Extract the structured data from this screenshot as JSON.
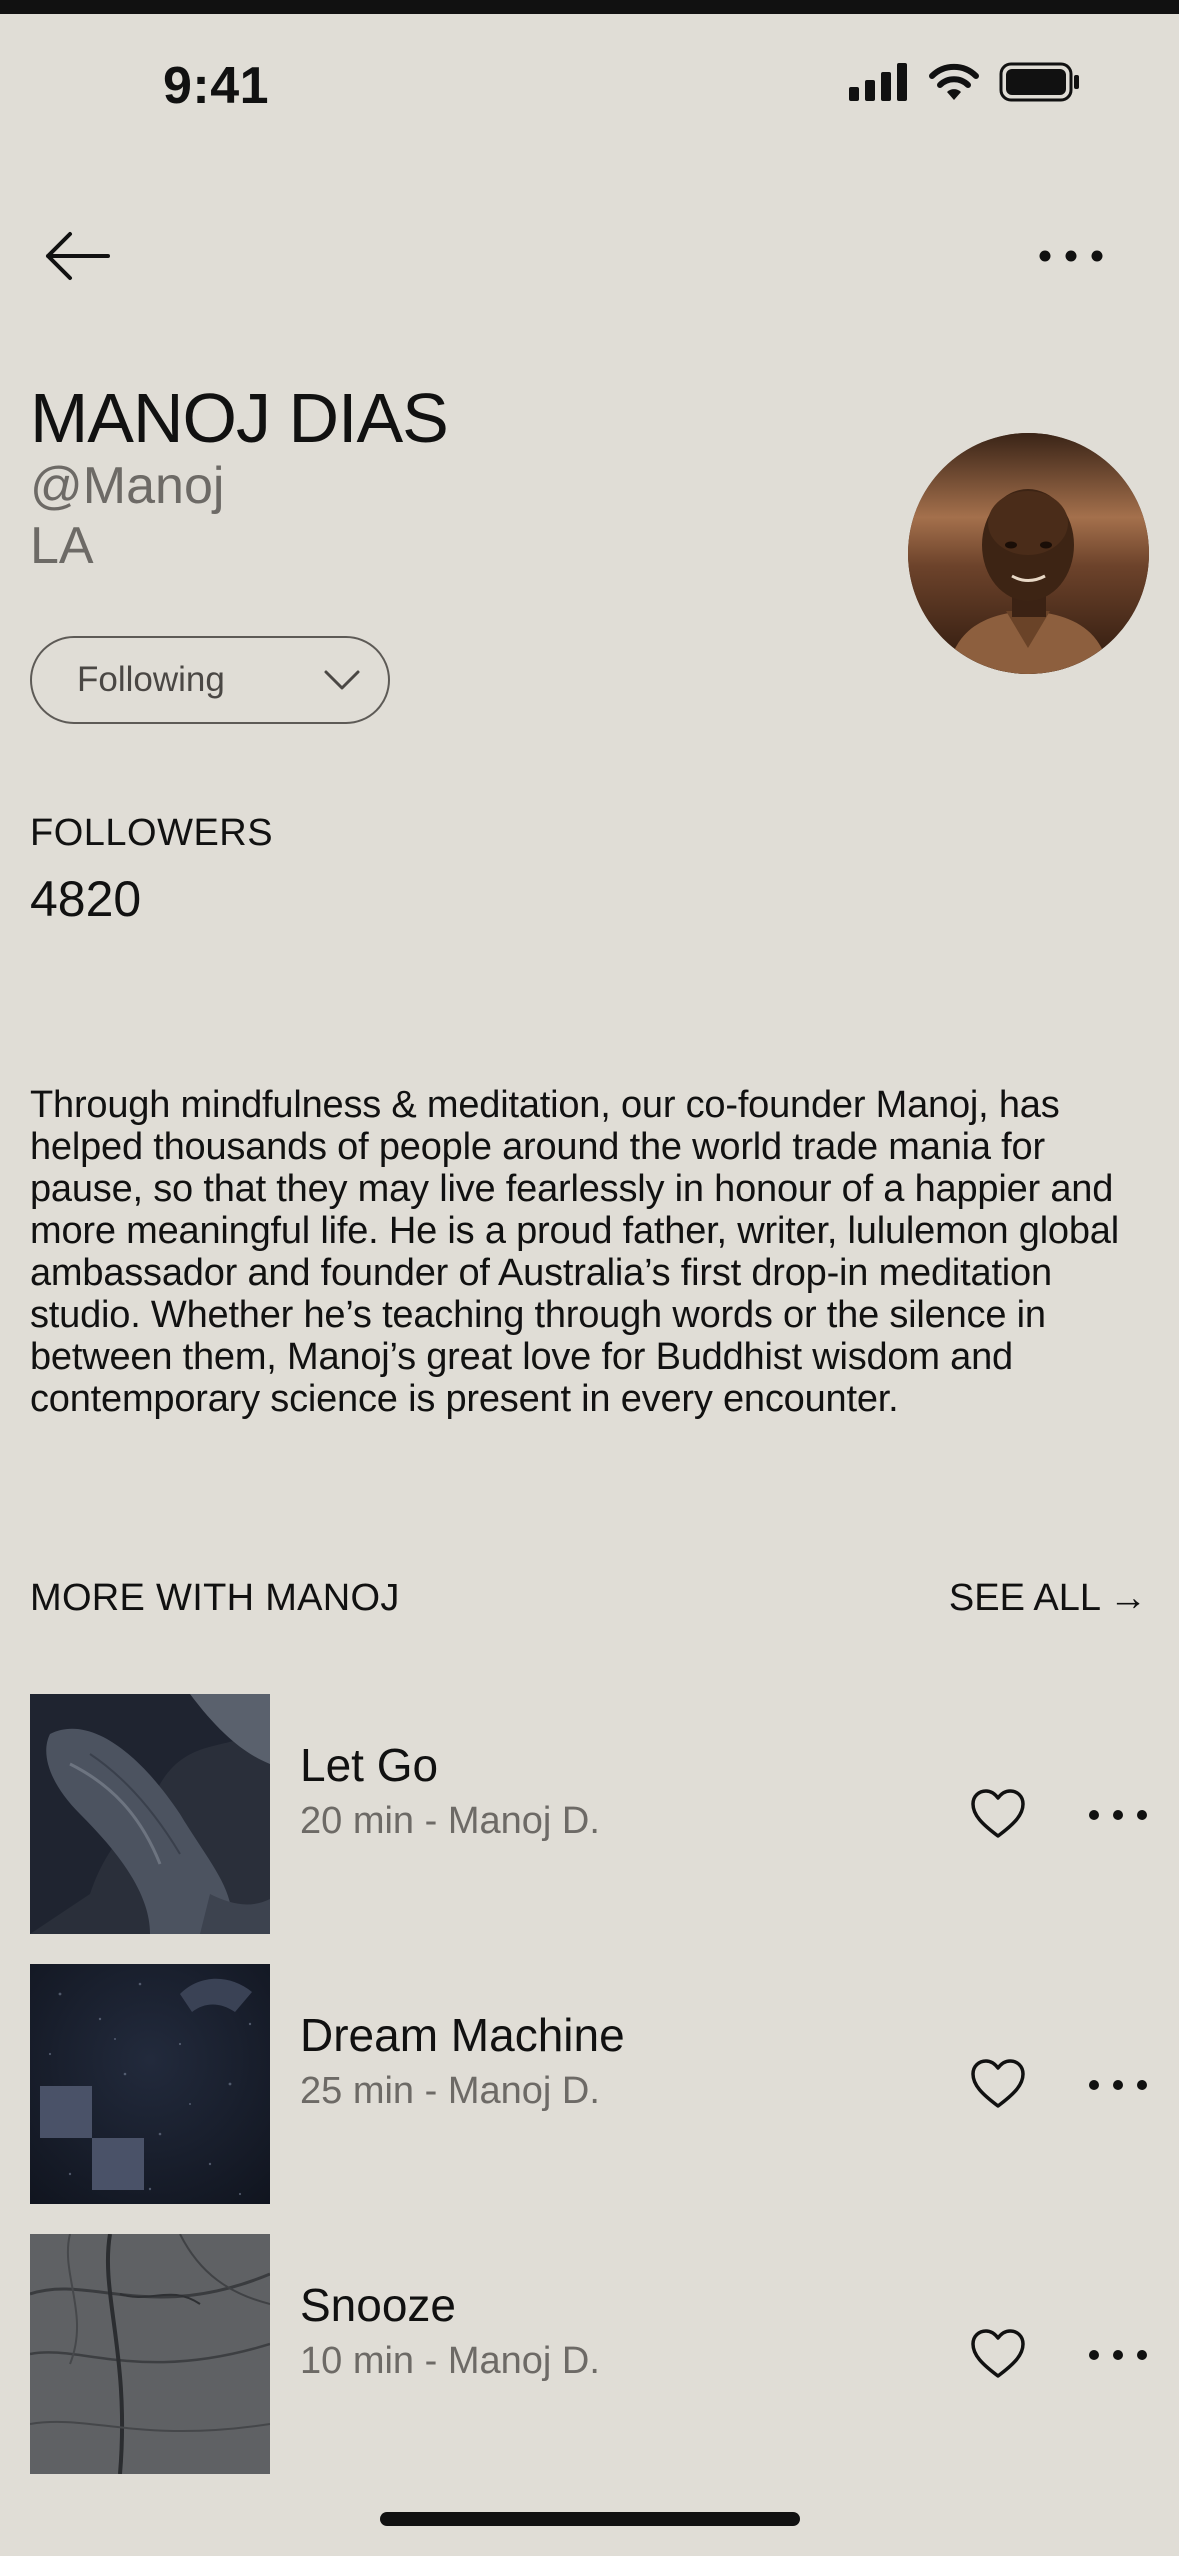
{
  "status_bar": {
    "time": "9:41"
  },
  "profile": {
    "name": "MANOJ DIAS",
    "handle": "@Manoj",
    "location": "LA",
    "follow_state": "Following",
    "followers_label": "FOLLOWERS",
    "followers_count": "4820",
    "bio": "Through mindfulness & meditation, our co-founder Manoj, has helped thousands of people around the world trade mania for pause, so that they may live fearlessly in honour of a happier and more meaningful life. He is a proud father, writer, lululemon global ambassador and founder of Australia’s first drop-in meditation studio. Whether he’s teaching through words or the silence in between them, Manoj’s great love for Buddhist wisdom and contemporary science is present in every encounter."
  },
  "more_section": {
    "title": "MORE WITH MANOJ",
    "see_all": "SEE ALL",
    "see_all_arrow": "→",
    "tracks": [
      {
        "title": "Let Go",
        "meta": "20 min - Manoj D."
      },
      {
        "title": "Dream Machine",
        "meta": "25 min - Manoj D."
      },
      {
        "title": "Snooze",
        "meta": "10 min - Manoj D."
      }
    ]
  },
  "colors": {
    "background": "#e0ddd6",
    "text": "#111111",
    "muted": "#6d6a66"
  }
}
